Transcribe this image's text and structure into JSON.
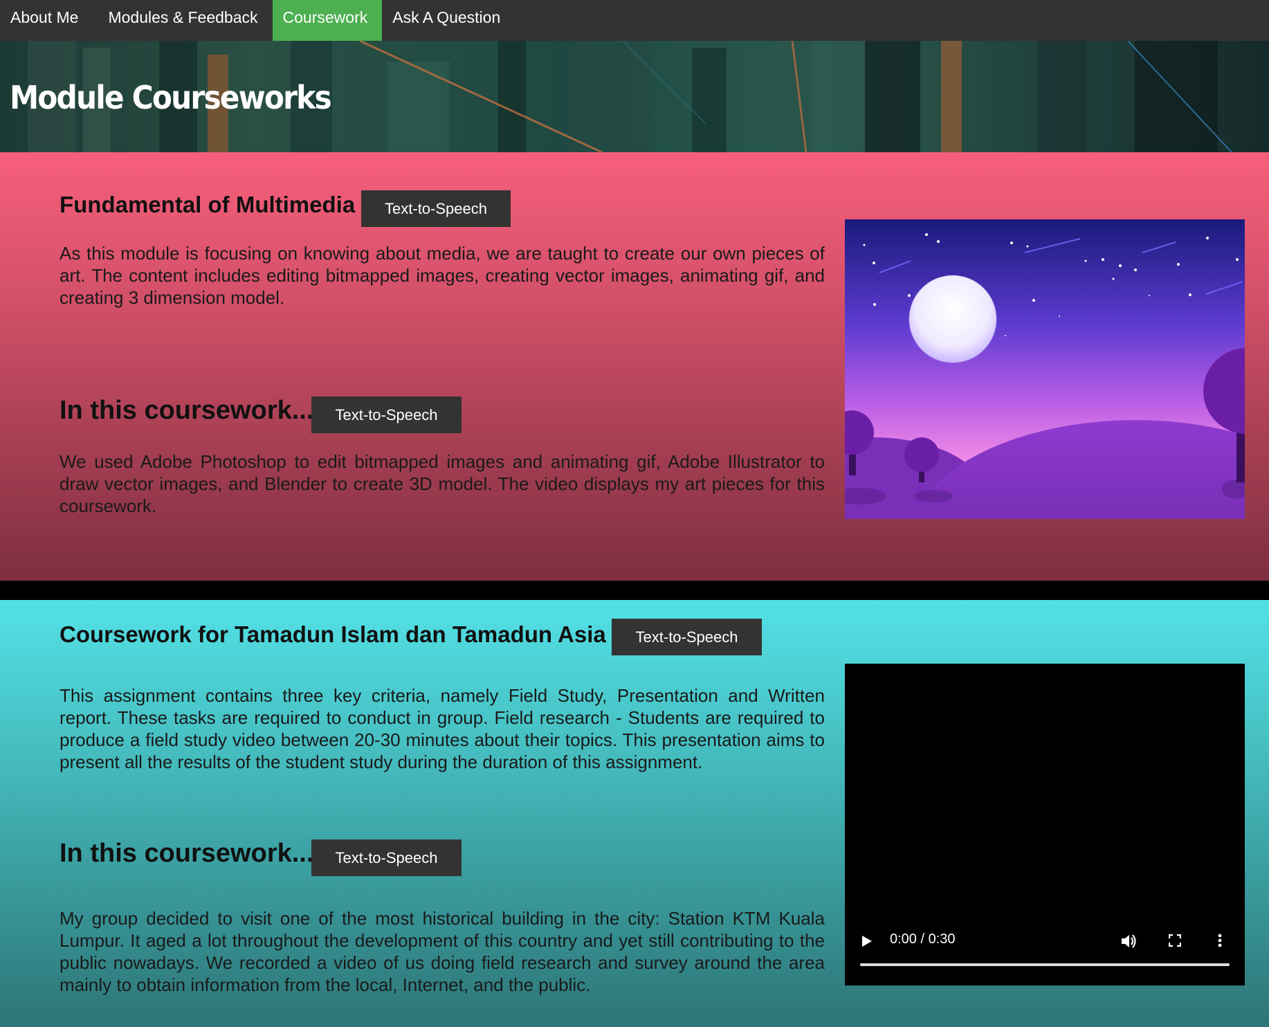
{
  "nav": {
    "items": [
      {
        "label": "About Me",
        "active": false
      },
      {
        "label": "Modules & Feedback",
        "active": false
      },
      {
        "label": "Coursework",
        "active": true
      },
      {
        "label": "Ask A Question",
        "active": false
      }
    ],
    "active_color": "#4caf50"
  },
  "hero": {
    "title": "Module Courseworks"
  },
  "multimedia": {
    "title": "Fundamental of Multimedia",
    "tts_label": "Text-to-Speech",
    "description": "As this module is focusing on knowing about media, we are taught to create our own pieces of art. The content includes editing bitmapped images, creating vector images, animating gif, and creating 3 dimension model.",
    "subheading": "In this coursework...",
    "sub_tts_label": "Text-to-Speech",
    "sub_description": "We used Adobe Photoshop to edit bitmapped images and animating gif, Adobe Illustrator to draw vector images, and Blender to create 3D model. The video displays my art pieces for this coursework."
  },
  "tamadun": {
    "title": "Coursework for Tamadun Islam dan Tamadun Asia",
    "tts_label": "Text-to-Speech",
    "description": "This assignment contains three key criteria, namely Field Study, Presentation and Written report. These tasks are required to conduct in group. Field research - Students are required to produce a field study video between 20-30 minutes about their topics. This presentation aims to present all the results of the student study during the duration of this assignment.",
    "subheading": "In this coursework...",
    "sub_tts_label": "Text-to-Speech",
    "sub_description": "My group decided to visit one of the most historical building in the city: Station KTM Kuala Lumpur. It aged a lot throughout the development of this country and yet still contributing to the public nowadays. We recorded a video of us doing field research and survey around the area mainly to obtain information from the local, Internet, and the public."
  },
  "video": {
    "time": "0:00 / 0:30",
    "icons": [
      "play-icon",
      "volume-icon",
      "fullscreen-icon",
      "more-options-icon"
    ]
  }
}
